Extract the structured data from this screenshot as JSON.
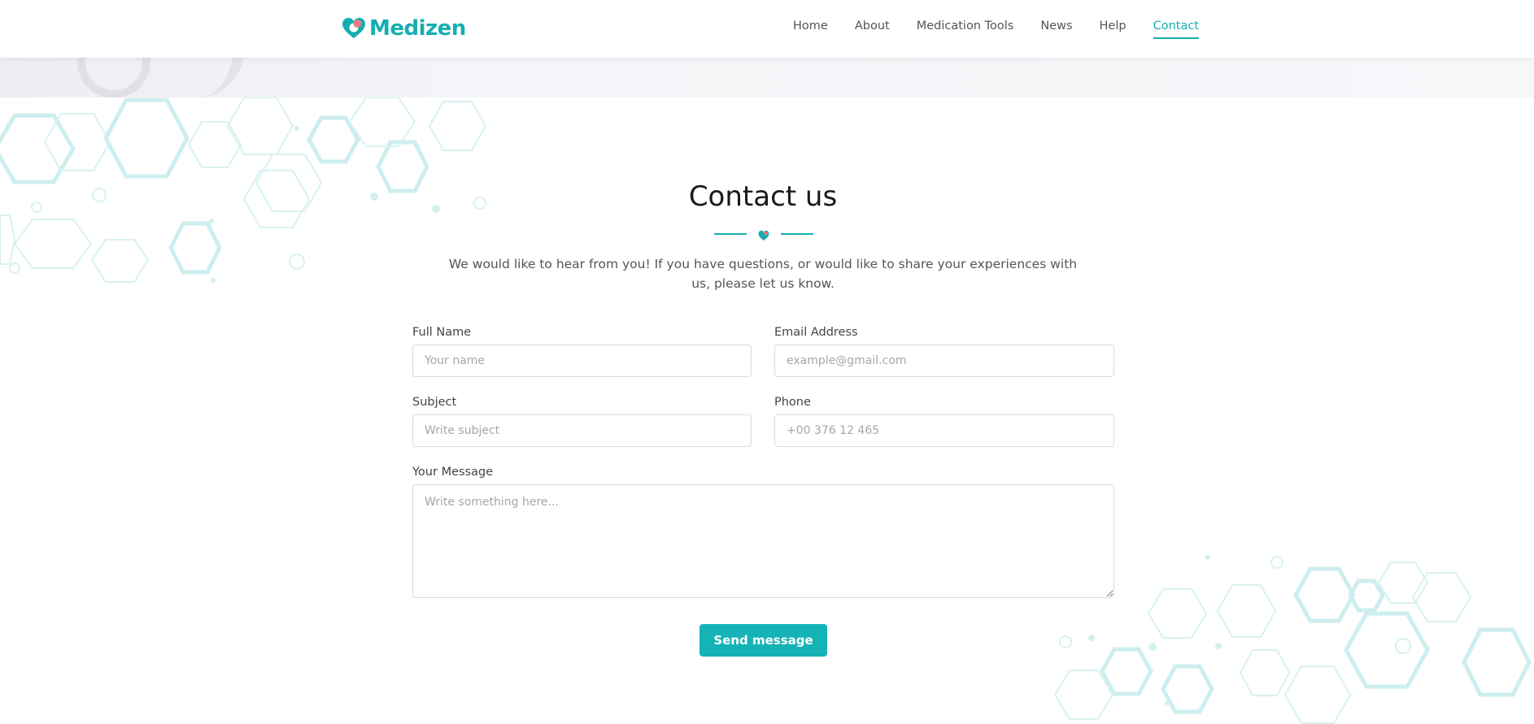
{
  "brand": {
    "name": "Medizen",
    "accent": "#15aeb0"
  },
  "nav": {
    "items": [
      {
        "label": "Home"
      },
      {
        "label": "About"
      },
      {
        "label": "Medication Tools"
      },
      {
        "label": "News"
      },
      {
        "label": "Help"
      },
      {
        "label": "Contact",
        "active": true
      }
    ]
  },
  "contact": {
    "title": "Contact us",
    "intro": "We would like to hear from you! If you have questions, or would like to share your experiences with us, please let us know.",
    "fields": {
      "full_name": {
        "label": "Full Name",
        "placeholder": "Your name",
        "value": ""
      },
      "email": {
        "label": "Email Address",
        "placeholder": "example@gmail.com",
        "value": ""
      },
      "subject": {
        "label": "Subject",
        "placeholder": "Write subject",
        "value": ""
      },
      "phone": {
        "label": "Phone",
        "placeholder": "+00 376 12 465",
        "value": ""
      },
      "message": {
        "label": "Your Message",
        "placeholder": "Write something here...",
        "value": ""
      }
    },
    "submit_label": "Send message"
  }
}
